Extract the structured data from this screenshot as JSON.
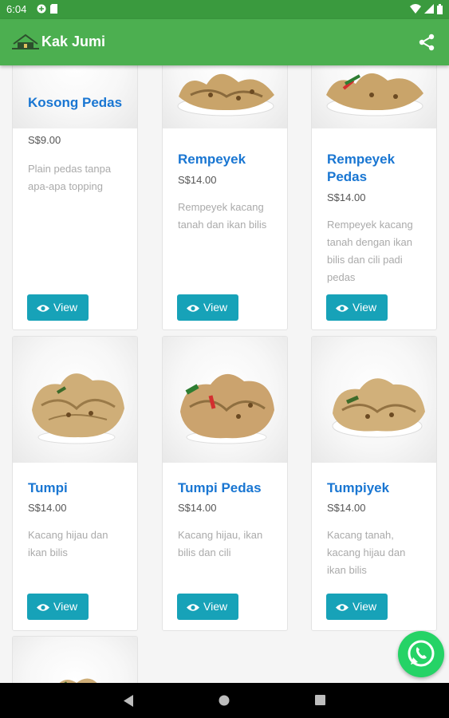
{
  "status_bar": {
    "time": "6:04"
  },
  "app_bar": {
    "title": "Kak Jumi",
    "share_icon": "share-icon",
    "logo_icon": "house-logo-icon"
  },
  "colors": {
    "app_bar": "#4caf50",
    "status_bar": "#3a9a3e",
    "product_name": "#1976d2",
    "view_button": "#17a2b8",
    "whatsapp": "#25d366"
  },
  "products": [
    {
      "name": "Kosong Pedas",
      "price": "S$9.00",
      "description": "Plain pedas tanpa apa-apa topping",
      "button": "View"
    },
    {
      "name": "Rempeyek",
      "price": "S$14.00",
      "description": "Rempeyek kacang tanah dan ikan bilis",
      "button": "View"
    },
    {
      "name": "Rempeyek Pedas",
      "price": "S$14.00",
      "description": "Rempeyek kacang tanah dengan ikan bilis dan cili padi pedas",
      "button": "View"
    },
    {
      "name": "Tumpi",
      "price": "S$14.00",
      "description": "Kacang hijau dan ikan bilis",
      "button": "View"
    },
    {
      "name": "Tumpi Pedas",
      "price": "S$14.00",
      "description": "Kacang hijau, ikan bilis dan cili",
      "button": "View"
    },
    {
      "name": "Tumpiyek",
      "price": "S$14.00",
      "description": "Kacang tanah, kacang hijau dan ikan bilis",
      "button": "View"
    }
  ],
  "fab": {
    "icon": "whatsapp-icon"
  },
  "nav_bar": {
    "back_icon": "back-icon",
    "home_icon": "home-icon",
    "recents_icon": "recents-icon"
  }
}
